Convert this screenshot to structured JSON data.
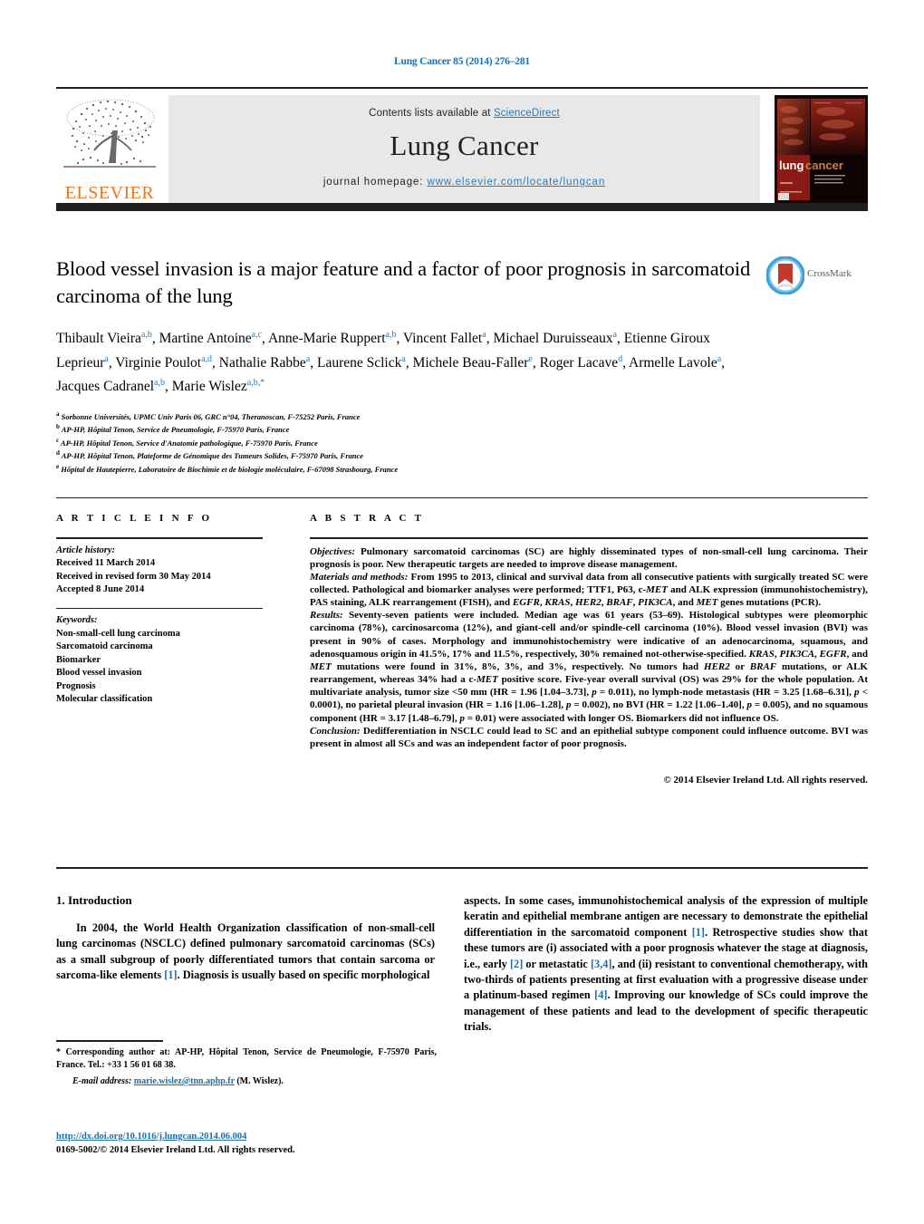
{
  "running_head": "Lung Cancer 85 (2014) 276–281",
  "masthead": {
    "contents_prefix": "Contents lists available at ",
    "sciencedirect": "ScienceDirect",
    "journal_title": "Lung Cancer",
    "homepage_label": "journal homepage: ",
    "homepage_url": "www.elsevier.com/locate/lungcan",
    "publisher_wordmark": "ELSEVIER",
    "publisher_logo_icon": "elsevier-tree-icon",
    "cover_title_part1": "lung",
    "cover_title_part2": "cancer"
  },
  "crossmark": {
    "label": "CrossMark",
    "icon": "crossmark-icon"
  },
  "article": {
    "title": "Blood vessel invasion is a major feature and a factor of poor prognosis in sarcomatoid carcinoma of the lung",
    "authors_html": "Thibault Vieira<sup>a,b</sup>, Martine Antoine<sup>a,c</sup>, Anne-Marie Ruppert<sup>a,b</sup>, Vincent Fallet<sup>a</sup>, Michael Duruisseaux<sup>a</sup>, Etienne Giroux Leprieur<sup>a</sup>, Virginie Poulot<sup>a,d</sup>, Nathalie Rabbe<sup>a</sup>, Laurene Sclick<sup>a</sup>, Michele Beau-Faller<sup>e</sup>, Roger Lacave<sup>d</sup>, Armelle Lavole<sup>a</sup>, Jacques Cadranel<sup>a,b</sup>, Marie Wislez<sup>a,b,</sup><sup class=\"star\">*</sup>",
    "affiliations": [
      {
        "marker": "a",
        "text": "Sorbonne Universités, UPMC Univ Paris 06, GRC n°04, Theranoscan, F-75252 Paris, France"
      },
      {
        "marker": "b",
        "text": "AP-HP, Hôpital Tenon, Service de Pneumologie, F-75970 Paris, France"
      },
      {
        "marker": "c",
        "text": "AP-HP, Hôpital Tenon, Service d'Anatomie pathologique, F-75970 Paris, France"
      },
      {
        "marker": "d",
        "text": "AP-HP, Hôpital Tenon, Plateforme de Génomique des Tumeurs Solides, F-75970 Paris, France"
      },
      {
        "marker": "e",
        "text": "Hôpital de Hautepierre, Laboratoire de Biochimie et de biologie moléculaire, F-67098 Strasbourg, France"
      }
    ]
  },
  "article_info": {
    "heading": "A R T I C L E    I N F O",
    "history_label": "Article history:",
    "history": [
      "Received 11 March 2014",
      "Received in revised form 30 May 2014",
      "Accepted 8 June 2014"
    ],
    "keywords_label": "Keywords:",
    "keywords": [
      "Non-small-cell lung carcinoma",
      "Sarcomatoid carcinoma",
      "Biomarker",
      "Blood vessel invasion",
      "Prognosis",
      "Molecular classification"
    ]
  },
  "abstract": {
    "heading": "A B S T R A C T",
    "objectives_label": "Objectives:",
    "objectives_text": " Pulmonary sarcomatoid carcinomas (SC) are highly disseminated types of non-small-cell lung carcinoma. Their prognosis is poor. New therapeutic targets are needed to improve disease management.",
    "methods_label": "Materials and methods:",
    "methods_text": " From 1995 to 2013, clinical and survival data from all consecutive patients with surgically treated SC were collected. Pathological and biomarker analyses were performed; TTF1, P63, c-MET and ALK expression (immunohistochemistry), PAS staining, ALK rearrangement (FISH), and EGFR, KRAS, HER2, BRAF, PIK3CA, and MET genes mutations (PCR).",
    "results_label": "Results:",
    "results_text": " Seventy-seven patients were included. Median age was 61 years (53–69). Histological subtypes were pleomorphic carcinoma (78%), carcinosarcoma (12%), and giant-cell and/or spindle-cell carcinoma (10%). Blood vessel invasion (BVI) was present in 90% of cases. Morphology and immunohistochemistry were indicative of an adenocarcinoma, squamous, and adenosquamous origin in 41.5%, 17% and 11.5%, respectively, 30% remained not-otherwise-specified. KRAS, PIK3CA, EGFR, and MET mutations were found in 31%, 8%, 3%, and 3%, respectively. No tumors had HER2 or BRAF mutations, or ALK rearrangement, whereas 34% had a c-MET positive score. Five-year overall survival (OS) was 29% for the whole population. At multivariate analysis, tumor size <50 mm (HR = 1.96 [1.04–3.73], p = 0.011), no lymph-node metastasis (HR = 3.25 [1.68–6.31], p < 0.0001), no parietal pleural invasion (HR = 1.16 [1.06–1.28], p = 0.002), no BVI (HR = 1.22 [1.06–1.40], p = 0.005), and no squamous component (HR = 3.17 [1.48–6.79], p = 0.01) were associated with longer OS. Biomarkers did not influence OS.",
    "conclusion_label": "Conclusion:",
    "conclusion_text": " Dedifferentiation in NSCLC could lead to SC and an epithelial subtype component could influence outcome. BVI was present in almost all SCs and was an independent factor of poor prognosis.",
    "copyright": "© 2014 Elsevier Ireland Ltd. All rights reserved."
  },
  "introduction": {
    "heading": "1. Introduction",
    "paragraph_left": "In 2004, the World Health Organization classification of non-small-cell lung carcinomas (NSCLC) defined pulmonary sarcomatoid carcinomas (SCs) as a small subgroup of poorly differentiated tumors that contain sarcoma or sarcoma-like elements [1]. Diagnosis is usually based on specific morphological",
    "paragraph_right": "aspects. In some cases, immunohistochemical analysis of the expression of multiple keratin and epithelial membrane antigen are necessary to demonstrate the epithelial differentiation in the sarcomatoid component [1]. Retrospective studies show that these tumors are (i) associated with a poor prognosis whatever the stage at diagnosis, i.e., early [2] or metastatic [3,4], and (ii) resistant to conventional chemotherapy, with two-thirds of patients presenting at first evaluation with a progressive disease under a platinum-based regimen [4]. Improving our knowledge of SCs could improve the management of these patients and lead to the development of specific therapeutic trials."
  },
  "footnote": {
    "star": "*",
    "text": " Corresponding author at: AP-HP, Hôpital Tenon, Service de Pneumologie, F-75970 Paris, France. Tel.: +33 1 56 01 68 38.",
    "email_label": "E-mail address:",
    "email": "marie.wislez@tnn.aphp.fr",
    "email_suffix": " (M. Wislez)."
  },
  "doi_block": {
    "doi_url": "http://dx.doi.org/10.1016/j.lungcan.2014.06.004",
    "issn_line": "0169-5002/© 2014 Elsevier Ireland Ltd. All rights reserved."
  },
  "colors": {
    "link_blue": "#1d6ea8",
    "sciencedirect_blue": "#2b7bb9",
    "elsevier_orange": "#E87722",
    "rule_dark": "#231f20",
    "band_grey": "#e8e8e8"
  }
}
